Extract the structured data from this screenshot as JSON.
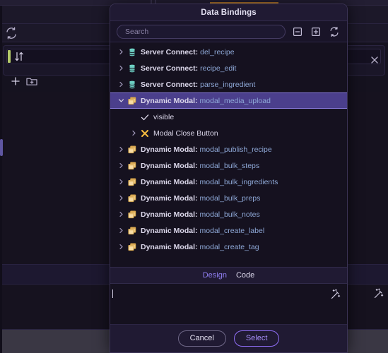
{
  "background": {
    "refresh_icon": "refresh-icon",
    "sort_icon": "sort-arrows-icon",
    "close_icon": "close-x-icon",
    "add_icon": "plus-icon",
    "add_folder_icon": "folder-plus-icon",
    "wand_icon": "magic-wand-icon",
    "accent_green": "#b5cc6a",
    "accent_amber": "#b5772a",
    "accent_purple": "#7a6fd0"
  },
  "dialog": {
    "title": "Data Bindings",
    "search": {
      "value": "",
      "placeholder": "Search"
    },
    "toolbar": [
      {
        "name": "collapse-all-button",
        "icon": "minus-box-icon"
      },
      {
        "name": "expand-all-button",
        "icon": "plus-box-icon"
      },
      {
        "name": "refresh-button",
        "icon": "refresh-icon"
      }
    ],
    "tree": [
      {
        "chevron": "right",
        "icon": "database-icon",
        "label": "Server Connect:",
        "value": "del_recipe",
        "selected": false,
        "indent": 0
      },
      {
        "chevron": "right",
        "icon": "database-icon",
        "label": "Server Connect:",
        "value": "recipe_edit",
        "selected": false,
        "indent": 0
      },
      {
        "chevron": "right",
        "icon": "database-icon",
        "label": "Server Connect:",
        "value": "parse_ingredient",
        "selected": false,
        "indent": 0
      },
      {
        "chevron": "down",
        "icon": "modal-icon",
        "label": "Dynamic Modal:",
        "value": "modal_media_upload",
        "selected": true,
        "indent": 0
      },
      {
        "chevron": "none",
        "icon": "check-icon",
        "label": "",
        "value": "",
        "plain": "visible",
        "selected": false,
        "indent": 1
      },
      {
        "chevron": "right",
        "icon": "close-x-icon",
        "label": "",
        "value": "",
        "plain": "Modal Close Button",
        "selected": false,
        "indent": 1
      },
      {
        "chevron": "right",
        "icon": "modal-icon",
        "label": "Dynamic Modal:",
        "value": "modal_publish_recipe",
        "selected": false,
        "indent": 0
      },
      {
        "chevron": "right",
        "icon": "modal-icon",
        "label": "Dynamic Modal:",
        "value": "modal_bulk_steps",
        "selected": false,
        "indent": 0
      },
      {
        "chevron": "right",
        "icon": "modal-icon",
        "label": "Dynamic Modal:",
        "value": "modal_bulk_ingredients",
        "selected": false,
        "indent": 0
      },
      {
        "chevron": "right",
        "icon": "modal-icon",
        "label": "Dynamic Modal:",
        "value": "modal_bulk_preps",
        "selected": false,
        "indent": 0
      },
      {
        "chevron": "right",
        "icon": "modal-icon",
        "label": "Dynamic Modal:",
        "value": "modal_bulk_notes",
        "selected": false,
        "indent": 0
      },
      {
        "chevron": "right",
        "icon": "modal-icon",
        "label": "Dynamic Modal:",
        "value": "modal_create_label",
        "selected": false,
        "indent": 0
      },
      {
        "chevron": "right",
        "icon": "modal-icon",
        "label": "Dynamic Modal:",
        "value": "modal_create_tag",
        "selected": false,
        "indent": 0
      }
    ],
    "tabs": [
      {
        "label": "Design",
        "active": true
      },
      {
        "label": "Code",
        "active": false
      }
    ],
    "code_editor": {
      "value": "",
      "wand_icon": "magic-wand-icon"
    },
    "buttons": {
      "cancel": "Cancel",
      "select": "Select"
    }
  }
}
